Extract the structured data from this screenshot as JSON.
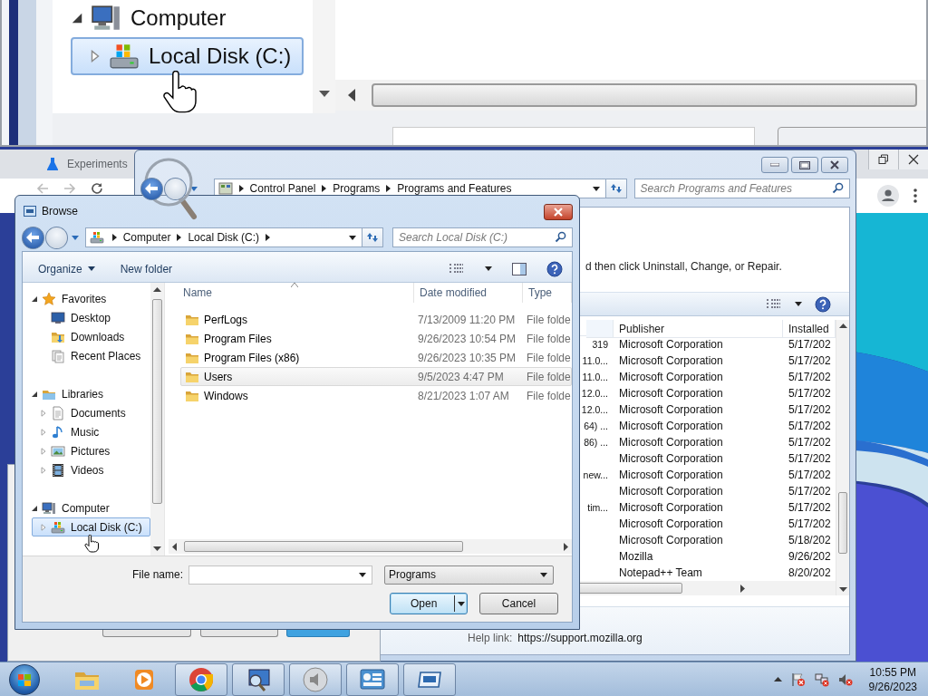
{
  "magnified_view": {
    "tree": [
      {
        "label": "Computer",
        "kind": "computer",
        "expanded": true,
        "selected": false,
        "children": [
          {
            "label": "Local Disk (C:)",
            "kind": "disk",
            "expanded": false,
            "selected": true
          }
        ]
      }
    ]
  },
  "browser": {
    "tab": "Experiments"
  },
  "programs_window": {
    "breadcrumb": [
      "Control Panel",
      "Programs",
      "Programs and Features"
    ],
    "search": {
      "placeholder": "Search Programs and Features"
    },
    "instruction": "d then click Uninstall, Change, or Repair.",
    "table": {
      "columns": [
        "Publisher",
        "Installed"
      ],
      "rows": [
        {
          "column_1": "319",
          "publisher": "Microsoft Corporation",
          "installed": "5/17/202"
        },
        {
          "column_1": "11.0...",
          "publisher": "Microsoft Corporation",
          "installed": "5/17/202"
        },
        {
          "column_1": "11.0...",
          "publisher": "Microsoft Corporation",
          "installed": "5/17/202"
        },
        {
          "column_1": "12.0...",
          "publisher": "Microsoft Corporation",
          "installed": "5/17/202"
        },
        {
          "column_1": "12.0...",
          "publisher": "Microsoft Corporation",
          "installed": "5/17/202"
        },
        {
          "column_1": "64) ...",
          "publisher": "Microsoft Corporation",
          "installed": "5/17/202"
        },
        {
          "column_1": "86) ...",
          "publisher": "Microsoft Corporation",
          "installed": "5/17/202"
        },
        {
          "publisher": "Microsoft Corporation",
          "installed": "5/17/202"
        },
        {
          "column_1": "new...",
          "publisher": "Microsoft Corporation",
          "installed": "5/17/202"
        },
        {
          "publisher": "Microsoft Corporation",
          "installed": "5/17/202"
        },
        {
          "column_1": "tim...",
          "publisher": "Microsoft Corporation",
          "installed": "5/17/202"
        },
        {
          "publisher": "Microsoft Corporation",
          "installed": "5/17/202"
        },
        {
          "publisher": "Microsoft Corporation",
          "installed": "5/18/202"
        },
        {
          "publisher": "Mozilla",
          "installed": "9/26/202"
        },
        {
          "publisher": "Notepad++ Team",
          "installed": "8/20/202"
        }
      ]
    },
    "help_link": {
      "label": "Help link:",
      "url": "https://support.mozilla.org"
    }
  },
  "browse_dialog": {
    "title": "Browse",
    "breadcrumb": [
      "Computer",
      "Local Disk (C:)"
    ],
    "search": {
      "placeholder": "Search Local Disk (C:)"
    },
    "toolbar": [
      "Organize",
      "New folder"
    ],
    "nav_tree": [
      {
        "label": "Favorites",
        "kind": "star",
        "expanded": true,
        "selected": false,
        "children": [
          {
            "label": "Desktop",
            "kind": "desktop",
            "selected": false
          },
          {
            "label": "Downloads",
            "kind": "downloads",
            "selected": false
          },
          {
            "label": "Recent Places",
            "kind": "recent",
            "selected": false
          }
        ]
      },
      {
        "label": "Libraries",
        "kind": "library",
        "expanded": true,
        "selected": false,
        "children": [
          {
            "label": "Documents",
            "kind": "documents",
            "expanded": false,
            "selected": false
          },
          {
            "label": "Music",
            "kind": "music",
            "expanded": false,
            "selected": false
          },
          {
            "label": "Pictures",
            "kind": "pictures",
            "expanded": false,
            "selected": false
          },
          {
            "label": "Videos",
            "kind": "videos",
            "expanded": false,
            "selected": false
          }
        ]
      },
      {
        "label": "Computer",
        "kind": "computer",
        "expanded": true,
        "selected": false,
        "children": [
          {
            "label": "Local Disk (C:)",
            "kind": "disk",
            "expanded": false,
            "selected": true
          }
        ]
      }
    ],
    "columns": [
      "Name",
      "Date modified",
      "Type"
    ],
    "files": [
      {
        "name": "PerfLogs",
        "date": "7/13/2009 11:20 PM",
        "type": "File folde",
        "hovered": false
      },
      {
        "name": "Program Files",
        "date": "9/26/2023 10:54 PM",
        "type": "File folde",
        "hovered": false
      },
      {
        "name": "Program Files (x86)",
        "date": "9/26/2023 10:35 PM",
        "type": "File folde",
        "hovered": false
      },
      {
        "name": "Users",
        "date": "9/5/2023 4:47 PM",
        "type": "File folde",
        "hovered": true
      },
      {
        "name": "Windows",
        "date": "8/21/2023 1:07 AM",
        "type": "File folde",
        "hovered": false
      }
    ],
    "file_name": {
      "label": "File name:"
    },
    "file_type": "Programs",
    "buttons": [
      "Open",
      "Cancel"
    ]
  },
  "taskbar": {
    "apps": [
      {
        "kind": "explorer",
        "open": false
      },
      {
        "kind": "media",
        "open": false
      },
      {
        "kind": "browser",
        "open": true
      },
      {
        "kind": "search",
        "open": true
      },
      {
        "kind": "speaker",
        "open": true
      },
      {
        "kind": "panel",
        "open": true
      },
      {
        "kind": "window",
        "open": true
      }
    ],
    "clock": {
      "time": "10:55 PM",
      "date": "9/26/2023"
    }
  }
}
